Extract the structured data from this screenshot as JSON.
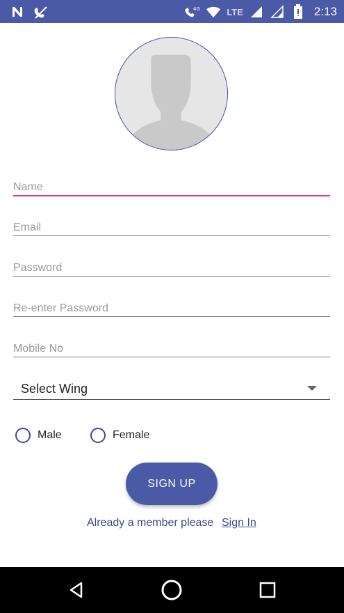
{
  "status_bar": {
    "left_icons": [
      "n-notification-icon",
      "phone-muted-icon"
    ],
    "right_icons": [
      "wifi-call-icon",
      "wifi-icon",
      "signal-icon",
      "signal-icon-2",
      "battery-icon"
    ],
    "lte_label": "LTE",
    "time": "2:13",
    "color": "#4a5aa6"
  },
  "avatar": {
    "icon": "person-silhouette-icon"
  },
  "form": {
    "name_placeholder": "Name",
    "email_placeholder": "Email",
    "password_placeholder": "Password",
    "reenter_password_placeholder": "Re-enter Password",
    "mobile_placeholder": "Mobile No",
    "wing_select_label": "Select Wing",
    "gender_options": [
      "Male",
      "Female"
    ]
  },
  "actions": {
    "signup_label": "SIGN UP",
    "footer_text": "Already a member please",
    "signin_label": "Sign In"
  },
  "nav_bar": {
    "icons": [
      "back-icon",
      "home-icon",
      "recents-icon"
    ]
  },
  "colors": {
    "accent": "#e8386f",
    "primary": "#4a5aa6",
    "link": "#3a4a8a"
  }
}
